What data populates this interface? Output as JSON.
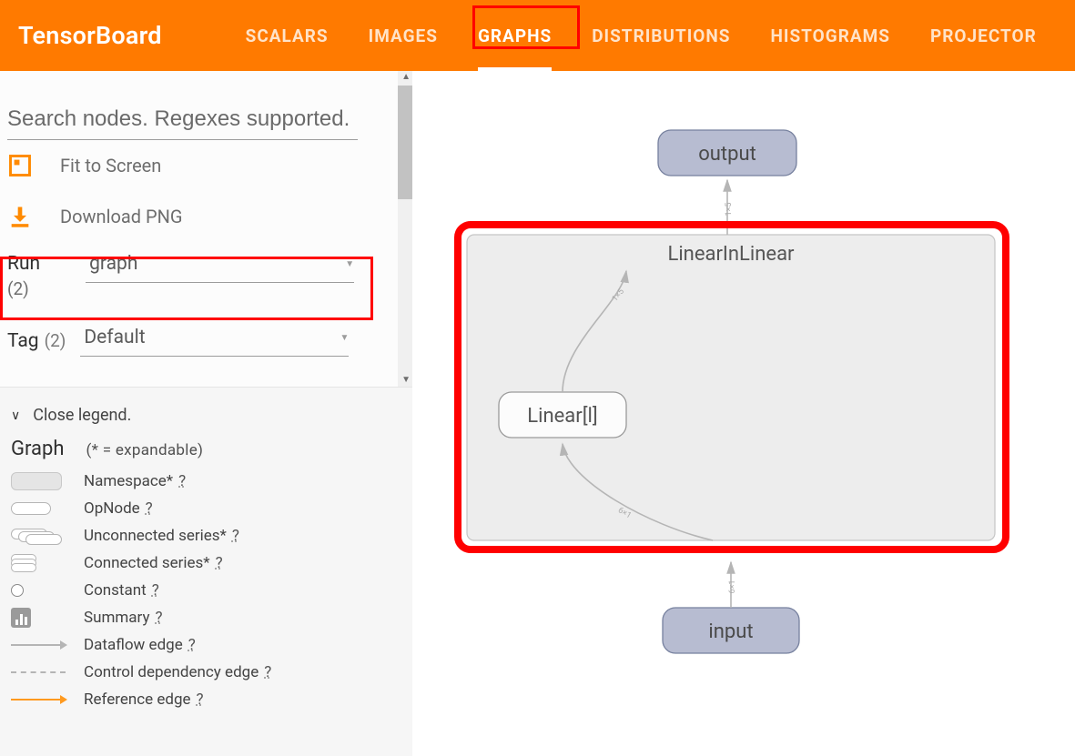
{
  "header": {
    "logo": "TensorBoard",
    "tabs": [
      {
        "label": "SCALARS",
        "active": false
      },
      {
        "label": "IMAGES",
        "active": false
      },
      {
        "label": "GRAPHS",
        "active": true
      },
      {
        "label": "DISTRIBUTIONS",
        "active": false
      },
      {
        "label": "HISTOGRAMS",
        "active": false
      },
      {
        "label": "PROJECTOR",
        "active": false
      }
    ]
  },
  "sidebar": {
    "search_placeholder": "Search nodes. Regexes supported.",
    "fit_label": "Fit to Screen",
    "download_label": "Download PNG",
    "run": {
      "label": "Run",
      "count": "(2)",
      "value": "graph"
    },
    "tag": {
      "label": "Tag",
      "count": "(2)",
      "value": "Default"
    },
    "legend": {
      "toggle": "Close legend.",
      "title": "Graph",
      "subtitle": "(* = expandable)",
      "items": [
        {
          "label": "Namespace* "
        },
        {
          "label": "OpNode "
        },
        {
          "label": "Unconnected series* "
        },
        {
          "label": "Connected series* "
        },
        {
          "label": "Constant "
        },
        {
          "label": "Summary "
        },
        {
          "label": "Dataflow edge "
        },
        {
          "label": "Control dependency edge "
        },
        {
          "label": "Reference edge "
        }
      ],
      "help": "?"
    }
  },
  "graph": {
    "output_label": "output",
    "input_label": "input",
    "module_name": "LinearInLinear",
    "op_name": "Linear[l]",
    "edge_out": "1×5",
    "edge_mid": "1×5",
    "edge_in": "6×1"
  }
}
